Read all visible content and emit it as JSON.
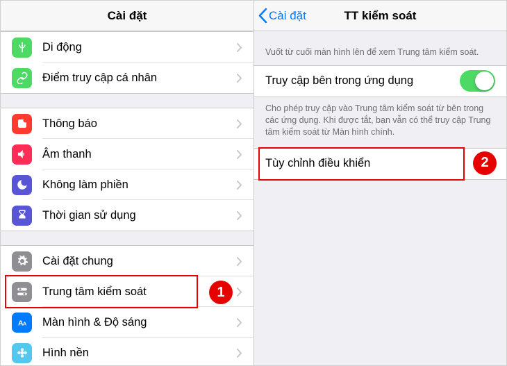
{
  "left": {
    "title": "Cài đặt",
    "groups": [
      {
        "rows": [
          {
            "id": "cellular",
            "label": "Di động",
            "iconBg": "#4cd964",
            "iconName": "antenna-icon"
          },
          {
            "id": "hotspot",
            "label": "Điểm truy cập cá nhân",
            "iconBg": "#4cd964",
            "iconName": "link-icon"
          }
        ]
      },
      {
        "rows": [
          {
            "id": "notifications",
            "label": "Thông báo",
            "iconBg": "#ff3b30",
            "iconName": "notification-icon"
          },
          {
            "id": "sounds",
            "label": "Âm thanh",
            "iconBg": "#ff2d55",
            "iconName": "sound-icon"
          },
          {
            "id": "dnd",
            "label": "Không làm phiền",
            "iconBg": "#5856d6",
            "iconName": "moon-icon"
          },
          {
            "id": "screentime",
            "label": "Thời gian sử dụng",
            "iconBg": "#5856d6",
            "iconName": "hourglass-icon"
          }
        ]
      },
      {
        "rows": [
          {
            "id": "general",
            "label": "Cài đặt chung",
            "iconBg": "#8e8e93",
            "iconName": "gear-icon"
          },
          {
            "id": "controlcenter",
            "label": "Trung tâm kiểm soát",
            "iconBg": "#8e8e93",
            "iconName": "switches-icon",
            "highlighted": true,
            "badge": "1"
          },
          {
            "id": "display",
            "label": "Màn hình & Độ sáng",
            "iconBg": "#007aff",
            "iconName": "text-size-icon"
          },
          {
            "id": "wallpaper",
            "label": "Hình nền",
            "iconBg": "#54c7ec",
            "iconName": "flower-icon"
          }
        ]
      }
    ]
  },
  "right": {
    "backLabel": "Cài đặt",
    "title": "TT kiểm soát",
    "note1": "Vuốt từ cuối màn hình lên để xem Trung tâm kiểm soát.",
    "accessRow": {
      "label": "Truy cập bên trong ứng dụng",
      "on": true
    },
    "note2": "Cho phép truy cập vào Trung tâm kiểm soát từ bên trong các ứng dụng. Khi được tắt, bạn vẫn có thể truy cập Trung tâm kiểm soát từ Màn hình chính.",
    "customizeRow": {
      "label": "Tùy chỉnh điều khiển",
      "highlighted": true,
      "badge": "2"
    }
  },
  "colors": {
    "accent": "#007aff",
    "highlight": "#e60000",
    "switchOn": "#4cd964"
  }
}
